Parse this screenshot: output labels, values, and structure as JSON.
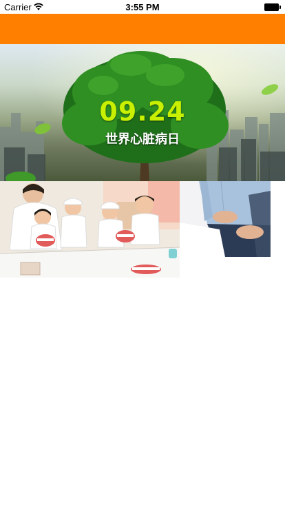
{
  "status_bar": {
    "carrier": "Carrier",
    "time": "3:55 PM",
    "icons": [
      "wifi-icon",
      "battery-icon"
    ]
  },
  "nav_bar": {
    "color": "#ff7f00"
  },
  "banner": {
    "date": "09.24",
    "title": "世界心脏病日",
    "date_color": "#c8f000"
  },
  "photos": [
    "children-dental-activity-photo",
    "stomach-pain-photo"
  ]
}
